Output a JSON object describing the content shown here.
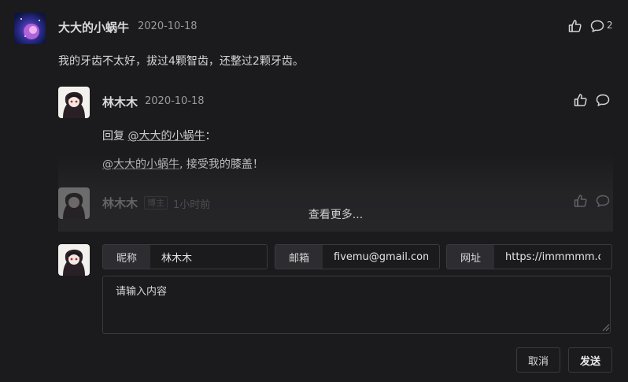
{
  "comment": {
    "author": "大大的小蜗牛",
    "date": "2020-10-18",
    "text": "我的牙齿不太好，拔过4颗智齿，还整过2颗牙齿。",
    "reply_count": "2"
  },
  "reply1": {
    "author": "林木木",
    "date": "2020-10-18",
    "reply_prefix": "回复 ",
    "reply_target": "@大大的小蜗牛",
    "reply_suffix": "：",
    "mention": "@大大的小蜗牛",
    "text": ", 接受我的膝盖！"
  },
  "reply2": {
    "author": "林木木",
    "badge": "博主",
    "time": "1小时前"
  },
  "load_more": "查看更多...",
  "form": {
    "nickname_label": "昵称",
    "nickname_value": "林木木",
    "email_label": "邮箱",
    "email_value": "fivemu@gmail.com",
    "site_label": "网址",
    "site_value": "https://immmmm.com",
    "content_placeholder": "请输入内容",
    "cancel_label": "取消",
    "submit_label": "发送"
  }
}
